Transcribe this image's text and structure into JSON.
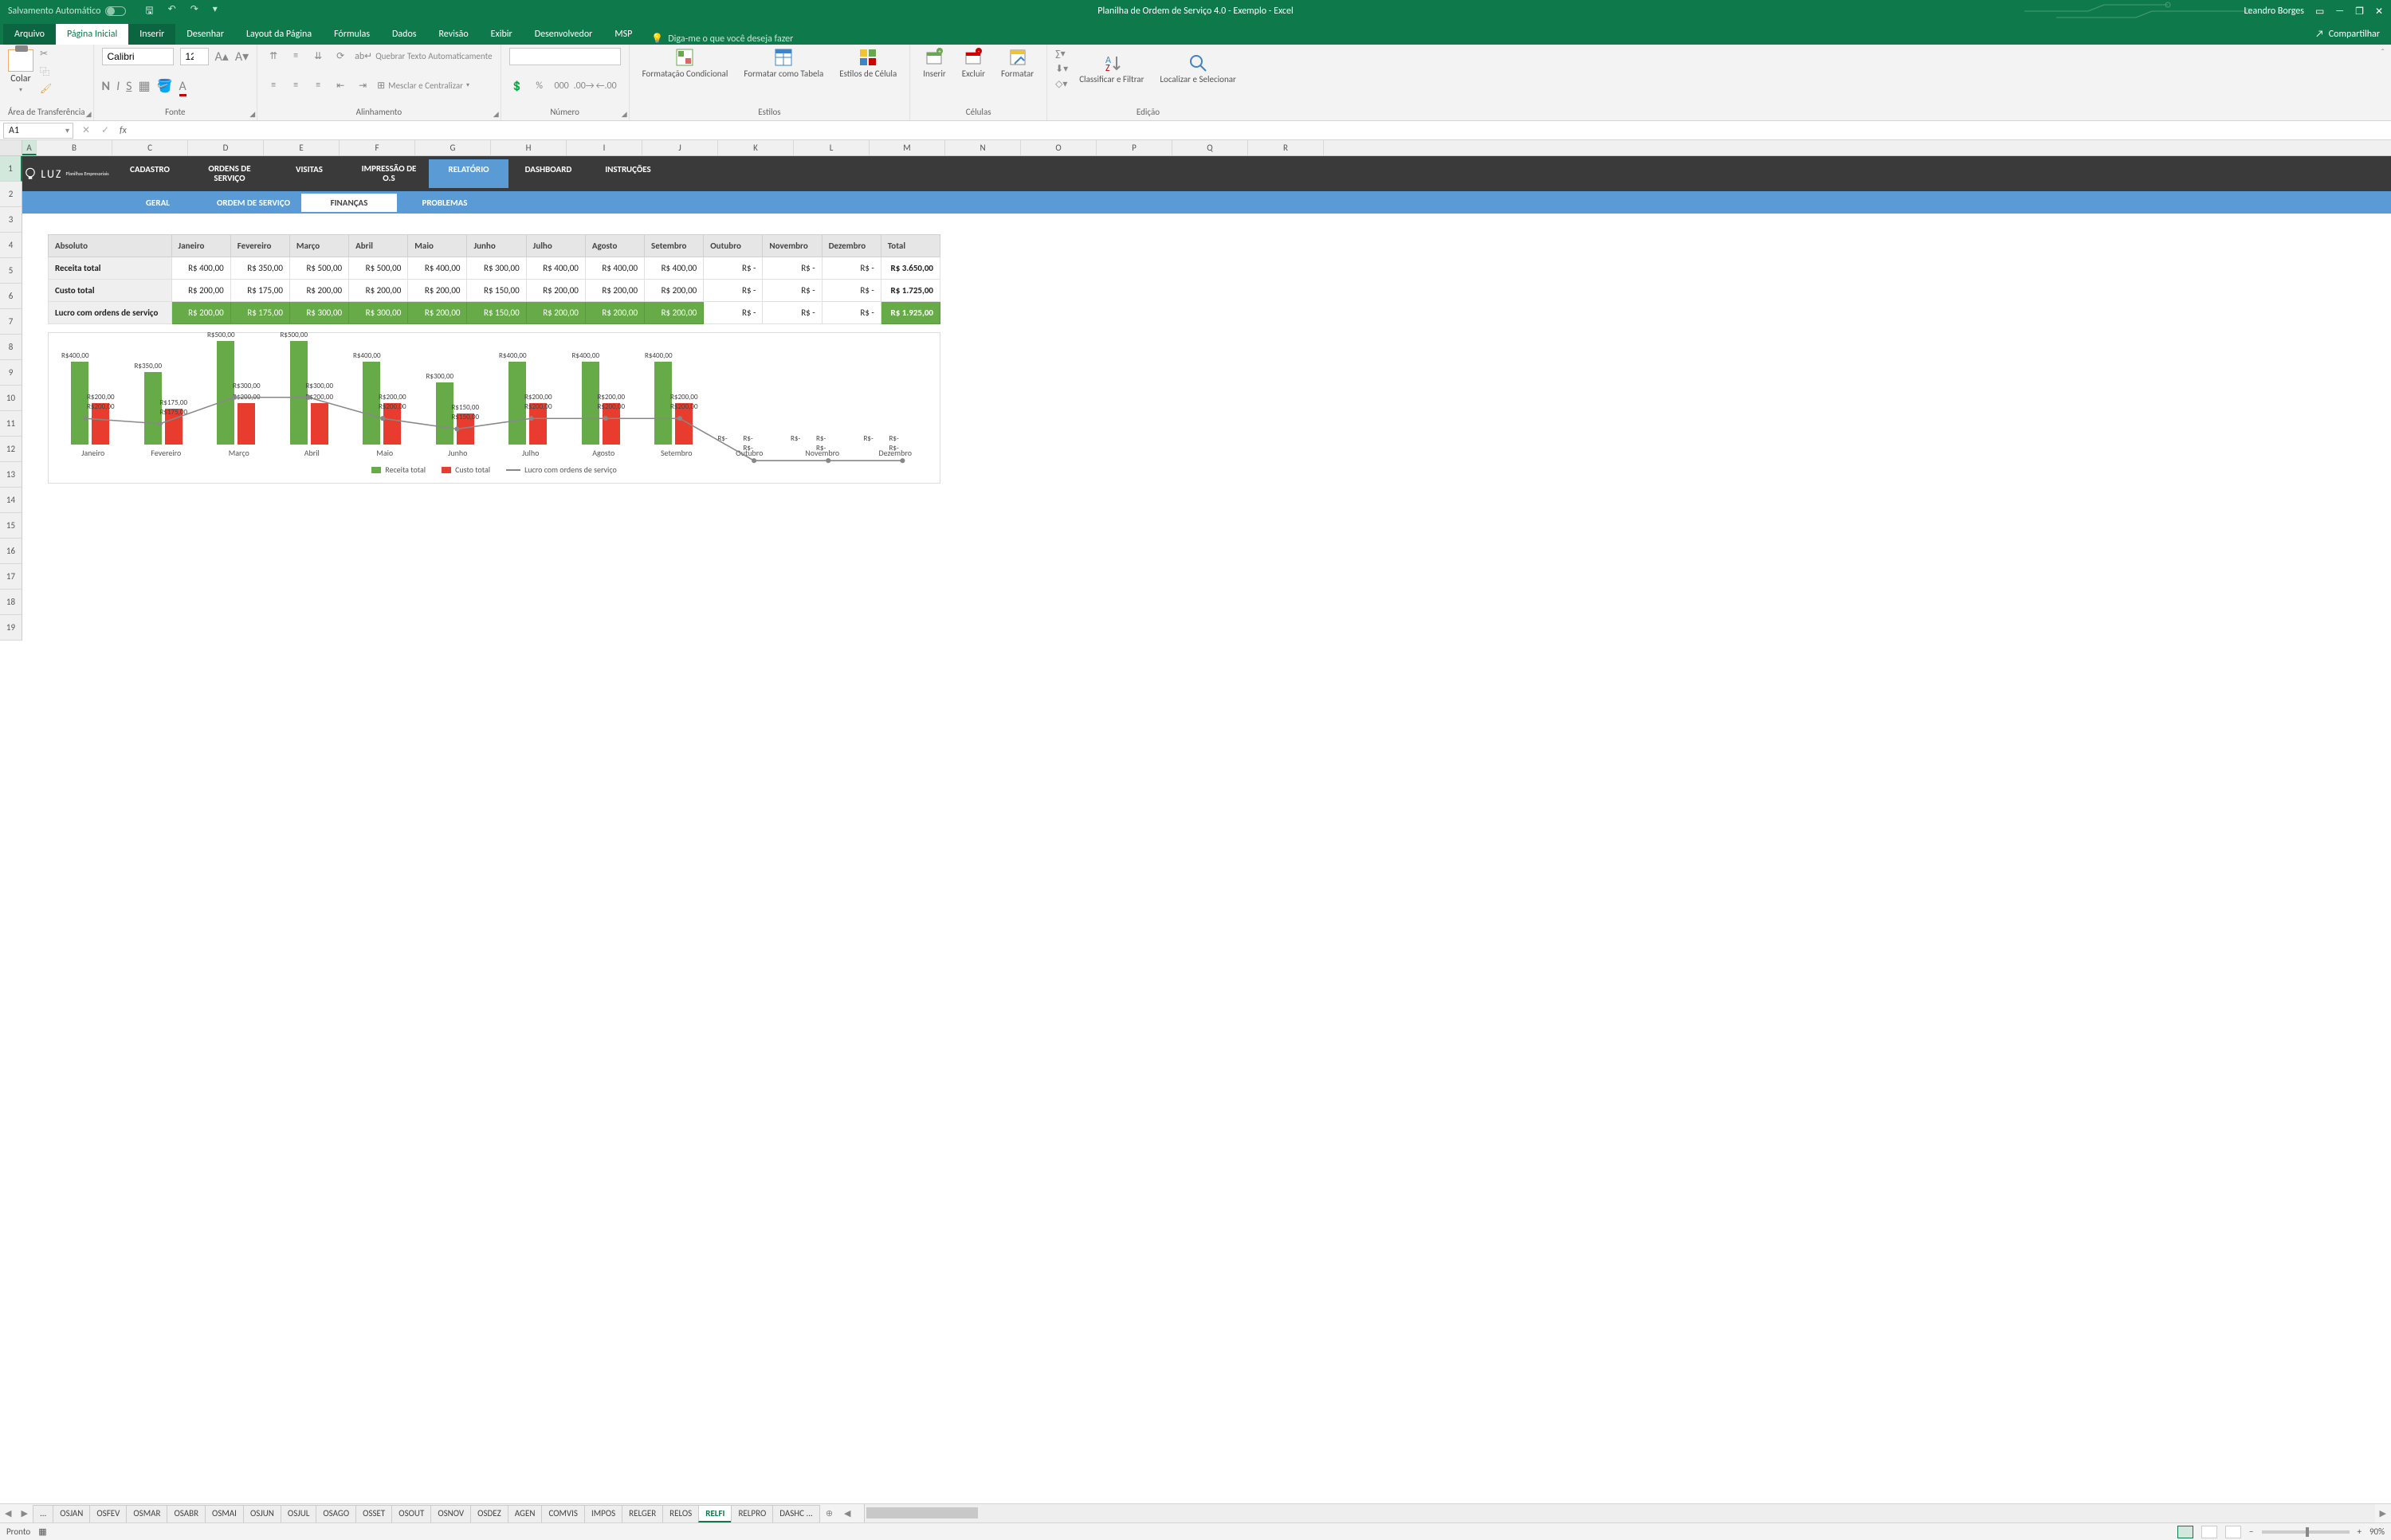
{
  "title_bar": {
    "autosave_label": "Salvamento Automático",
    "doc_title": "Planilha de Ordem de Serviço 4.0 - Exemplo  -  Excel",
    "user_name": "Leandro Borges"
  },
  "ribbon_tabs": {
    "file": "Arquivo",
    "home": "Página Inicial",
    "insert": "Inserir",
    "draw": "Desenhar",
    "layout": "Layout da Página",
    "formulas": "Fórmulas",
    "data": "Dados",
    "review": "Revisão",
    "view": "Exibir",
    "developer": "Desenvolvedor",
    "msp": "MSP",
    "tellme": "Diga-me o que você deseja fazer",
    "share": "Compartilhar"
  },
  "ribbon": {
    "clipboard": {
      "paste": "Colar",
      "group": "Área de Transferência"
    },
    "font": {
      "name": "Calibri",
      "size": "12",
      "group": "Fonte"
    },
    "alignment": {
      "wrap": "Quebrar Texto Automaticamente",
      "merge": "Mesclar e Centralizar",
      "group": "Alinhamento"
    },
    "number": {
      "group": "Número"
    },
    "styles": {
      "cond": "Formatação Condicional",
      "table": "Formatar como Tabela",
      "cell": "Estilos de Célula",
      "group": "Estilos"
    },
    "cells": {
      "insert": "Inserir",
      "delete": "Excluir",
      "format": "Formatar",
      "group": "Células"
    },
    "editing": {
      "sort": "Classificar e Filtrar",
      "find": "Localizar e Selecionar",
      "group": "Edição"
    }
  },
  "namebox": "A1",
  "template": {
    "logo": "LUZ",
    "logo_sub": "Planilhas Empresariais",
    "nav": [
      "CADASTRO",
      "ORDENS DE SERVIÇO",
      "VISITAS",
      "IMPRESSÃO DE O.S",
      "RELATÓRIO",
      "DASHBOARD",
      "INSTRUÇÕES"
    ],
    "subnav": [
      "GERAL",
      "ORDEM DE SERVIÇO",
      "FINANÇAS",
      "PROBLEMAS"
    ]
  },
  "table": {
    "header_label": "Absoluto",
    "months": [
      "Janeiro",
      "Fevereiro",
      "Março",
      "Abril",
      "Maio",
      "Junho",
      "Julho",
      "Agosto",
      "Setembro",
      "Outubro",
      "Novembro",
      "Dezembro"
    ],
    "total_label": "Total",
    "rows": [
      {
        "label": "Receita total",
        "values": [
          "R$   400,00",
          "R$   350,00",
          "R$   500,00",
          "R$   500,00",
          "R$   400,00",
          "R$   300,00",
          "R$   400,00",
          "R$   400,00",
          "R$   400,00",
          "R$          -",
          "R$          -",
          "R$          -"
        ],
        "total": "R$ 3.650,00"
      },
      {
        "label": "Custo total",
        "values": [
          "R$   200,00",
          "R$   175,00",
          "R$   200,00",
          "R$   200,00",
          "R$   200,00",
          "R$   150,00",
          "R$   200,00",
          "R$   200,00",
          "R$   200,00",
          "R$          -",
          "R$          -",
          "R$          -"
        ],
        "total": "R$ 1.725,00"
      },
      {
        "label": "Lucro com ordens de serviço",
        "values": [
          "R$   200,00",
          "R$   175,00",
          "R$   300,00",
          "R$   300,00",
          "R$   200,00",
          "R$   150,00",
          "R$   200,00",
          "R$   200,00",
          "R$   200,00",
          "R$          -",
          "R$          -",
          "R$          -"
        ],
        "total": "R$ 1.925,00"
      }
    ]
  },
  "chart_data": {
    "type": "bar",
    "categories": [
      "Janeiro",
      "Fevereiro",
      "Março",
      "Abril",
      "Maio",
      "Junho",
      "Julho",
      "Agosto",
      "Setembro",
      "Outubro",
      "Novembro",
      "Dezembro"
    ],
    "series": [
      {
        "name": "Receita total",
        "values": [
          400,
          350,
          500,
          500,
          400,
          300,
          400,
          400,
          400,
          0,
          0,
          0
        ],
        "color": "#67ab49"
      },
      {
        "name": "Custo total",
        "values": [
          200,
          175,
          200,
          200,
          200,
          150,
          200,
          200,
          200,
          0,
          0,
          0
        ],
        "color": "#e83c2e"
      },
      {
        "name": "Lucro com ordens de serviço",
        "values": [
          200,
          175,
          300,
          300,
          200,
          150,
          200,
          200,
          200,
          0,
          0,
          0
        ],
        "color": "#888888",
        "type": "line"
      }
    ],
    "ylim": [
      0,
      500
    ],
    "data_labels": {
      "revenue": [
        "R$400,00",
        "R$350,00",
        "R$500,00",
        "R$500,00",
        "R$400,00",
        "R$300,00",
        "R$400,00",
        "R$400,00",
        "R$400,00",
        "R$-",
        "R$-",
        "R$-"
      ],
      "cost": [
        "R$200,00",
        "R$175,00",
        "R$200,00",
        "R$200,00",
        "R$200,00",
        "R$150,00",
        "R$200,00",
        "R$200,00",
        "R$200,00",
        "R$-",
        "R$-",
        "R$-"
      ],
      "profit": [
        "R$200,00",
        "R$175,00",
        "R$300,00",
        "R$300,00",
        "R$200,00",
        "R$150,00",
        "R$200,00",
        "R$200,00",
        "R$200,00",
        "R$-",
        "R$-",
        "R$-"
      ]
    },
    "legend": [
      "Receita total",
      "Custo total",
      "Lucro com ordens de serviço"
    ]
  },
  "sheet_tabs": [
    "...",
    "OSJAN",
    "OSFEV",
    "OSMAR",
    "OSABR",
    "OSMAI",
    "OSJUN",
    "OSJUL",
    "OSAGO",
    "OSSET",
    "OSOUT",
    "OSNOV",
    "OSDEZ",
    "AGEN",
    "COMVIS",
    "IMPOS",
    "RELGER",
    "RELOS",
    "RELFI",
    "RELPRO",
    "DASHC ..."
  ],
  "active_sheet": "RELFI",
  "status": {
    "ready": "Pronto",
    "zoom": "90%"
  },
  "col_letters": [
    "A",
    "B",
    "C",
    "D",
    "E",
    "F",
    "G",
    "H",
    "I",
    "J",
    "K",
    "L",
    "M",
    "N",
    "O",
    "P",
    "Q",
    "R"
  ],
  "row_nums": [
    "1",
    "2",
    "3",
    "4",
    "5",
    "6",
    "7",
    "8",
    "9",
    "10",
    "11",
    "12",
    "13",
    "14",
    "15",
    "16",
    "17",
    "18",
    "19"
  ]
}
